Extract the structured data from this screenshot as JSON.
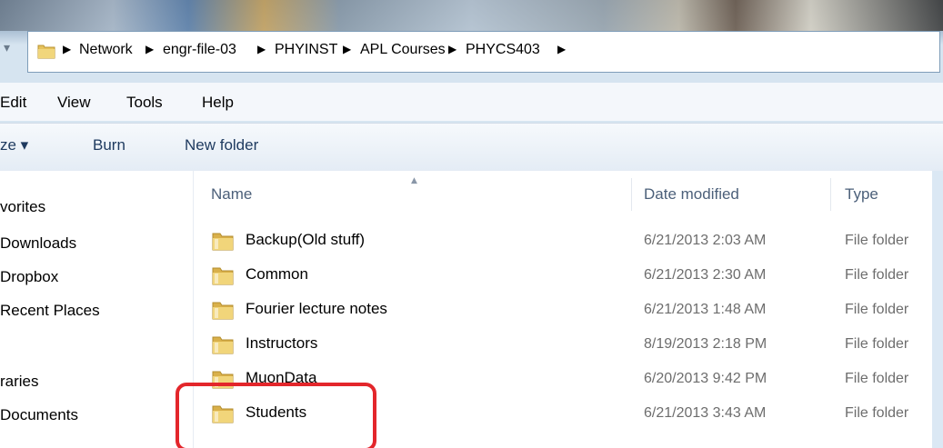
{
  "address": {
    "crumbs": [
      "Network",
      "engr-file-03",
      "PHYINST",
      "APL Courses",
      "PHYCS403"
    ]
  },
  "menu": {
    "edit": "Edit",
    "view": "View",
    "tools": "Tools",
    "help": "Help"
  },
  "toolbar": {
    "organize": "ze ▾",
    "burn": "Burn",
    "new_folder": "New folder"
  },
  "nav": {
    "favorites": "vorites",
    "downloads": "Downloads",
    "dropbox": "Dropbox",
    "recent": "Recent Places",
    "libraries": "raries",
    "documents": "Documents"
  },
  "columns": {
    "name": "Name",
    "date": "Date modified",
    "type": "Type"
  },
  "files": [
    {
      "name": "Backup(Old stuff)",
      "date": "6/21/2013 2:03 AM",
      "type": "File folder"
    },
    {
      "name": "Common",
      "date": "6/21/2013 2:30 AM",
      "type": "File folder"
    },
    {
      "name": "Fourier lecture notes",
      "date": "6/21/2013 1:48 AM",
      "type": "File folder"
    },
    {
      "name": "Instructors",
      "date": "8/19/2013 2:18 PM",
      "type": "File folder"
    },
    {
      "name": "MuonData",
      "date": "6/20/2013 9:42 PM",
      "type": "File folder"
    },
    {
      "name": "Students",
      "date": "6/21/2013 3:43 AM",
      "type": "File folder"
    }
  ],
  "colors": {
    "highlight": "#e3262b",
    "folder": "#e8c35a"
  }
}
